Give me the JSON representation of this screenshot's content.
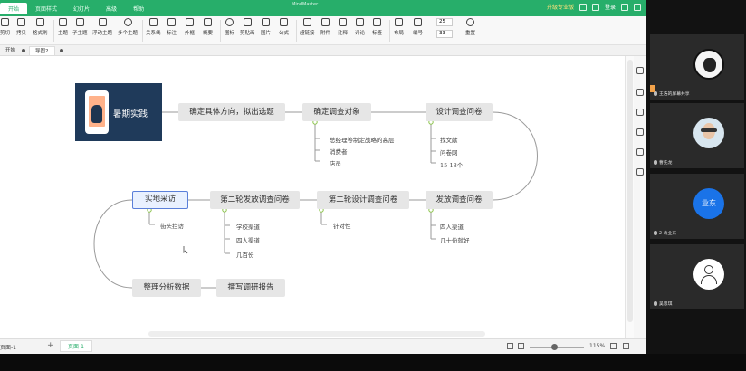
{
  "app": {
    "window_title": "MindMaster",
    "menu_tabs": [
      "开始",
      "页面样式",
      "幻灯片",
      "高级",
      "帮助"
    ],
    "active_menu": "开始",
    "promo": "升级专业版",
    "login": "登录",
    "toolbar": [
      {
        "label": "剪切"
      },
      {
        "label": "拷贝"
      },
      {
        "label": "格式刷"
      },
      {
        "label": "主题"
      },
      {
        "label": "子主题"
      },
      {
        "label": "浮动主题"
      },
      {
        "label": "多个主题"
      },
      {
        "label": "关系线"
      },
      {
        "label": "标注"
      },
      {
        "label": "外框"
      },
      {
        "label": "概要"
      },
      {
        "label": "图标"
      },
      {
        "label": "剪贴画"
      },
      {
        "label": "图片"
      },
      {
        "label": "公式"
      },
      {
        "label": "超链接"
      },
      {
        "label": "附件"
      },
      {
        "label": "注释"
      },
      {
        "label": "评论"
      },
      {
        "label": "标签"
      },
      {
        "label": "布局"
      },
      {
        "label": "编号"
      },
      {
        "label": "重置"
      }
    ],
    "font_size_1": "25",
    "font_size_2": "33",
    "doc_tabs": [
      "开始",
      "导图2"
    ],
    "status_page_label": "页面-1",
    "add_page": "+",
    "page_tab": "页面-1",
    "zoom": "115%"
  },
  "mindmap": {
    "root": "暑期实践",
    "n1": "确定具体方向，拟出选题",
    "n2": "确定调查对象",
    "n2_leaves": [
      "总经理等制定战略的高层",
      "消费者",
      "店员"
    ],
    "n3": "设计调查问卷",
    "n3_leaves": [
      "找文献",
      "问卷网",
      "15-18个"
    ],
    "n4": "发放调查问卷",
    "n4_leaves": [
      "四人渠道",
      "几十份就好"
    ],
    "n5": "第二轮设计调查问卷",
    "n5_leaves": [
      "针对性"
    ],
    "n6": "第二轮发放调查问卷",
    "n6_leaves": [
      "学校渠道",
      "四人渠道",
      "几百份"
    ],
    "n7": "实地采访",
    "n7_leaves": [
      "街头拦访"
    ],
    "n8": "整理分析数据",
    "n9": "撰写调研报告"
  },
  "meeting": {
    "share_label": "王浩的屏幕共享",
    "participants": [
      {
        "name": "王浩的屏幕共享",
        "avatar": "portrait"
      },
      {
        "name": "曹先龙",
        "avatar": "photo"
      },
      {
        "name": "2-袁业东",
        "avatar_text": "业东"
      },
      {
        "name": "吴思琪",
        "avatar": "default"
      }
    ]
  }
}
